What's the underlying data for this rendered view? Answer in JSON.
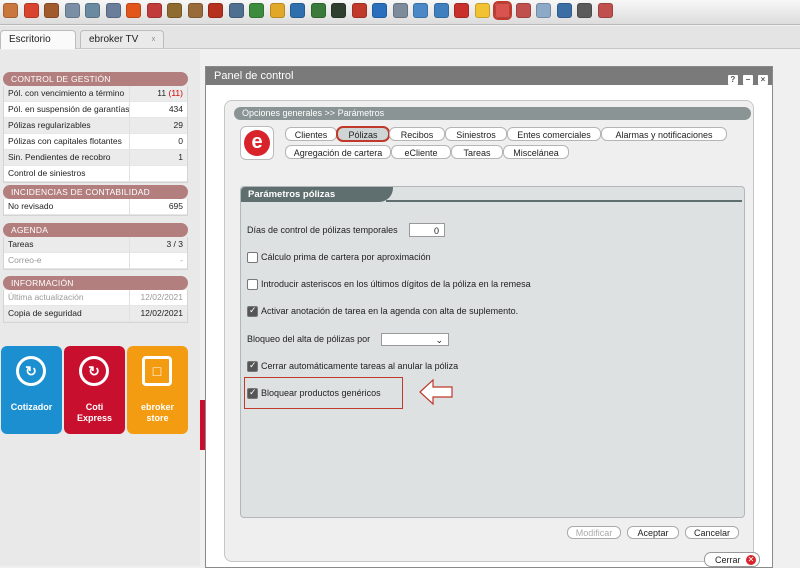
{
  "toolbar": {
    "icons": [
      {
        "name": "box-icon",
        "color": "#c9763f"
      },
      {
        "name": "person-star-icon",
        "color": "#d9442f"
      },
      {
        "name": "document-check-icon",
        "color": "#a05a2c"
      },
      {
        "name": "card-icon",
        "color": "#7a8fa6"
      },
      {
        "name": "money-card-icon",
        "color": "#6a8aa2"
      },
      {
        "name": "list-icon",
        "color": "#6a7d9a"
      },
      {
        "name": "fire-icon",
        "color": "#e2561c"
      },
      {
        "name": "target-icon",
        "color": "#c23b3b"
      },
      {
        "name": "pencil-icon",
        "color": "#8f6b30"
      },
      {
        "name": "briefcase-icon",
        "color": "#9a6b3a"
      },
      {
        "name": "printer-icon",
        "color": "#b5301f"
      },
      {
        "name": "house-icon",
        "color": "#4e6f8f"
      },
      {
        "name": "bottle-icon",
        "color": "#3d8b3d"
      },
      {
        "name": "user-icon",
        "color": "#e0a826"
      },
      {
        "name": "users-icon",
        "color": "#2f6fad"
      },
      {
        "name": "arrows-icon",
        "color": "#3a7a3a"
      },
      {
        "name": "globe-icon",
        "color": "#2f3f2f"
      },
      {
        "name": "car-icon",
        "color": "#c0392b"
      },
      {
        "name": "e-icon",
        "color": "#2a6fbd"
      },
      {
        "name": "tools-icon",
        "color": "#7d8b9a"
      },
      {
        "name": "down-arrow-icon",
        "color": "#4a88c7"
      },
      {
        "name": "s-icon",
        "color": "#3f7fbf"
      },
      {
        "name": "g-icon",
        "color": "#c9302c"
      },
      {
        "name": "bulb-icon",
        "color": "#f1c232"
      },
      {
        "name": "control-panel-icon",
        "color": "#d9534f"
      },
      {
        "name": "brush-icon",
        "color": "#c0504d"
      },
      {
        "name": "report-icon",
        "color": "#8caac7"
      },
      {
        "name": "phone-icon",
        "color": "#3b6ea5"
      },
      {
        "name": "gears-icon",
        "color": "#5b5b5b"
      },
      {
        "name": "help-icon",
        "color": "#c0504d"
      }
    ]
  },
  "tabs": {
    "escritorio": "Escritorio",
    "ebroker_tv": "ebroker TV",
    "close": "x"
  },
  "sidebar": {
    "control": {
      "title": "CONTROL DE GESTIÓN",
      "rows": [
        {
          "label": "Pól. con vencimiento a término",
          "value": "11",
          "extra": "(11)"
        },
        {
          "label": "Pól. en suspensión de garantías",
          "value": "434",
          "extra": ""
        },
        {
          "label": "Pólizas regularizables",
          "value": "29",
          "extra": ""
        },
        {
          "label": "Pólizas con capitales flotantes",
          "value": "0",
          "extra": ""
        },
        {
          "label": "Sin. Pendientes de recobro",
          "value": "1",
          "extra": ""
        },
        {
          "label": "Control de siniestros",
          "value": "",
          "extra": ""
        }
      ]
    },
    "incidencias": {
      "title": "INCIDENCIAS DE CONTABILIDAD",
      "rows": [
        {
          "label": "No revisado",
          "value": "695"
        }
      ]
    },
    "agenda": {
      "title": "AGENDA",
      "rows": [
        {
          "label": "Tareas",
          "value": "3 / 3"
        },
        {
          "label": "Correo-e",
          "value": "-"
        }
      ]
    },
    "informacion": {
      "title": "INFORMACIÓN",
      "rows": [
        {
          "label": "Última actualización",
          "value": "12/02/2021"
        },
        {
          "label": "Copia de seguridad",
          "value": "12/02/2021"
        }
      ]
    },
    "apps": [
      {
        "label_1": "Cotizador",
        "label_2": "",
        "color": "#1b8fd0"
      },
      {
        "label_1": "Coti",
        "label_2": "Express",
        "color": "#c8102e"
      },
      {
        "label_1": "ebroker",
        "label_2": "store",
        "color": "#f39c12"
      }
    ]
  },
  "panel": {
    "title": "Panel de control",
    "window_buttons": {
      "help": "?",
      "minimize": "−",
      "close": "×"
    },
    "breadcrumb": "Opciones generales >> Parámetros",
    "logo_letter": "e",
    "tabs_row1": [
      "Clientes",
      "Pólizas",
      "Recibos",
      "Siniestros",
      "Entes comerciales",
      "Alarmas y notificaciones"
    ],
    "tabs_row2": [
      "Agregación de cartera",
      "eCliente",
      "Tareas",
      "Miscelánea"
    ],
    "active_tab": "Pólizas",
    "params_title": "Parámetros pólizas",
    "options": {
      "dias_label": "Días de control de pólizas temporales",
      "dias_value": "0",
      "calculo_prima": "Cálculo prima de cartera por aproximación",
      "asteriscos": "Introducir asteriscos en los últimos dígitos de la póliza en la remesa",
      "activar_anotacion": "Activar anotación de tarea en la agenda con alta de suplemento.",
      "bloqueo_label": "Bloqueo del alta de pólizas por",
      "bloqueo_value": "",
      "cerrar_tareas": "Cerrar automáticamente tareas al anular la póliza",
      "bloquear_productos": "Bloquear productos genéricos"
    },
    "checked": {
      "calculo_prima": false,
      "asteriscos": false,
      "activar_anotacion": true,
      "cerrar_tareas": true,
      "bloquear_productos": true
    },
    "buttons": {
      "modificar": "Modificar",
      "aceptar": "Aceptar",
      "cancelar": "Cancelar",
      "cerrar": "Cerrar"
    }
  }
}
